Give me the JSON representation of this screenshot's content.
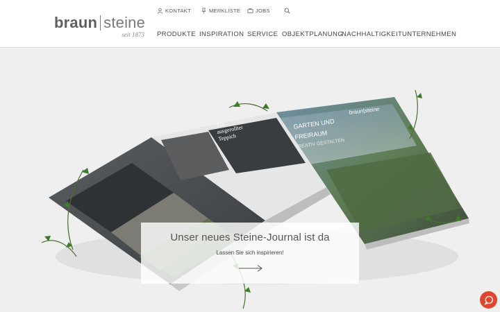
{
  "logo": {
    "brand_bold": "braun",
    "brand_light": "steine",
    "tagline": "seit 1873"
  },
  "top_links": [
    {
      "label": "KONTAKT",
      "icon": "user-icon"
    },
    {
      "label": "MERKLISTE",
      "icon": "pin-icon"
    },
    {
      "label": "JOBS",
      "icon": "briefcase-icon"
    }
  ],
  "nav": [
    {
      "label": "PRODUKTE"
    },
    {
      "label": "INSPIRATION"
    },
    {
      "label": "SERVICE"
    },
    {
      "label": "OBJEKTPLANUNG"
    },
    {
      "label": "NACHHALTIGKEIT"
    },
    {
      "label": "UNTERNEHMEN"
    }
  ],
  "hero": {
    "title": "Unser neues Steine-Journal ist da",
    "subtitle": "Lassen Sie sich inspirieren!",
    "magazine": {
      "cover_brand": "braun|steine",
      "cover_heading": "GARTEN UND FREIRAUM",
      "cover_sub": "KREATIV GESTALTEN",
      "page_heading": "Ein ausgerollter Teppich"
    }
  },
  "colors": {
    "accent": "#e0462f",
    "hero_bg": "#efefef",
    "text": "#555555"
  }
}
